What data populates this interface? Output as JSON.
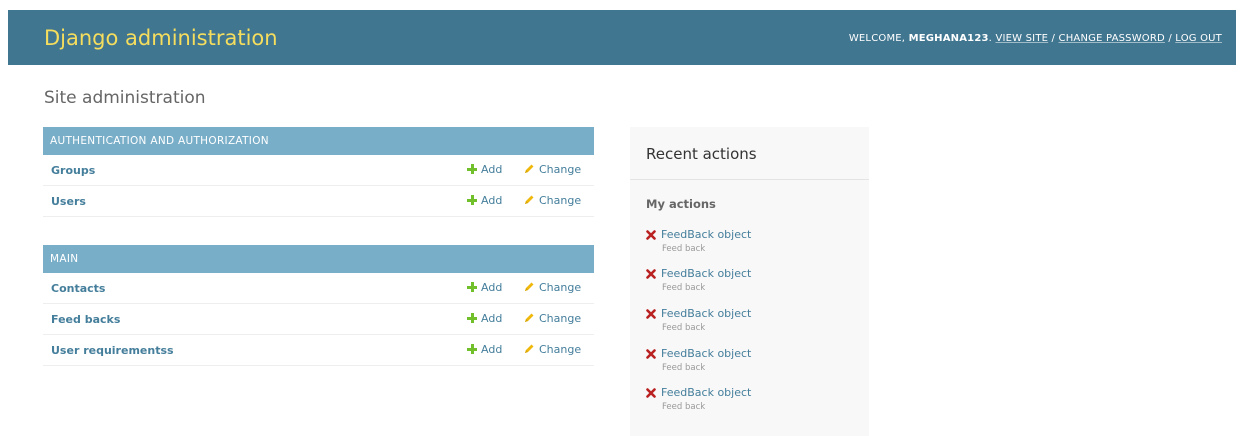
{
  "header": {
    "branding": "Django administration",
    "user_tools": {
      "welcome": "WELCOME,",
      "username": "MEGHANA123",
      "view_site": "VIEW SITE",
      "change_password": "CHANGE PASSWORD",
      "log_out": "LOG OUT",
      "separator": "/"
    }
  },
  "page": {
    "title": "Site administration"
  },
  "modules": [
    {
      "caption": "AUTHENTICATION AND AUTHORIZATION",
      "models": [
        {
          "name": "Groups",
          "add": "Add",
          "change": "Change"
        },
        {
          "name": "Users",
          "add": "Add",
          "change": "Change"
        }
      ]
    },
    {
      "caption": "MAIN",
      "models": [
        {
          "name": "Contacts",
          "add": "Add",
          "change": "Change"
        },
        {
          "name": "Feed backs",
          "add": "Add",
          "change": "Change"
        },
        {
          "name": "User requirementss",
          "add": "Add",
          "change": "Change"
        }
      ]
    }
  ],
  "recent_actions": {
    "title": "Recent actions",
    "subtitle": "My actions",
    "items": [
      {
        "object": "FeedBack object",
        "type": "Feed back",
        "icon": "delete-icon"
      },
      {
        "object": "FeedBack object",
        "type": "Feed back",
        "icon": "delete-icon"
      },
      {
        "object": "FeedBack object",
        "type": "Feed back",
        "icon": "delete-icon"
      },
      {
        "object": "FeedBack object",
        "type": "Feed back",
        "icon": "delete-icon"
      },
      {
        "object": "FeedBack object",
        "type": "Feed back",
        "icon": "delete-icon"
      }
    ]
  },
  "colors": {
    "header_bg": "#417690",
    "branding": "#f5dd5d",
    "caption_bg": "#79aec8",
    "link": "#447e9b",
    "add_icon": "#70bf2b",
    "change_icon": "#efb80b",
    "delete_icon": "#ba2121",
    "recent_bg": "#f8f8f8"
  }
}
